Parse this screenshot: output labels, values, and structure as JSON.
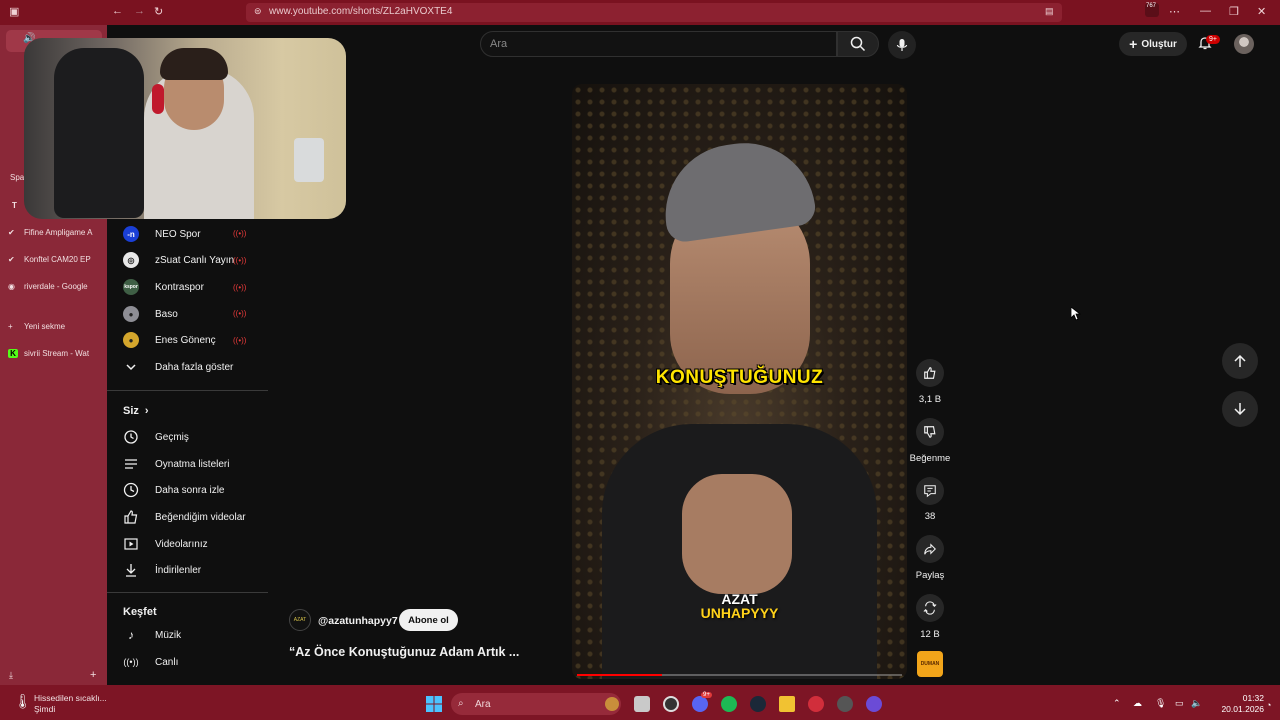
{
  "browser": {
    "url": "www.youtube.com/shorts/ZL2aHVOXTE4",
    "tab_count_badge": "767"
  },
  "tab_strip": {
    "section_label": "Spa",
    "pinned_letter": "T",
    "tabs": [
      {
        "label": "Fifine Ampligame A"
      },
      {
        "label": "Konftel CAM20 EP"
      },
      {
        "label": "riverdale - Google"
      }
    ],
    "new_tab_label": "Yeni sekme",
    "active_tab_label": "sivrii Stream - Wat"
  },
  "header": {
    "search_placeholder": "Ara",
    "create_label": "Oluştur",
    "notif_badge": "9+"
  },
  "sidebar": {
    "subscriptions": [
      {
        "name": "NEO Spor",
        "avatar": "n",
        "avatar_color": "#1a3fd6"
      },
      {
        "name": "zSuat Canlı Yayın",
        "avatar": "z",
        "avatar_color": "#e8e8e8"
      },
      {
        "name": "Kontraspor",
        "avatar": "k",
        "avatar_color": "#3f5f45"
      },
      {
        "name": "Baso",
        "avatar": "b",
        "avatar_color": "#8e8e95"
      },
      {
        "name": "Enes Gönenç",
        "avatar": "e",
        "avatar_color": "#d4a62c"
      }
    ],
    "show_more": "Daha fazla göster",
    "you_heading": "Siz",
    "you_items": [
      {
        "label": "Geçmiş",
        "icon": "history-icon"
      },
      {
        "label": "Oynatma listeleri",
        "icon": "playlists-icon"
      },
      {
        "label": "Daha sonra izle",
        "icon": "watch-later-icon"
      },
      {
        "label": "Beğendiğim videolar",
        "icon": "liked-icon"
      },
      {
        "label": "Videolarınız",
        "icon": "your-videos-icon"
      },
      {
        "label": "İndirilenler",
        "icon": "downloads-icon"
      }
    ],
    "explore_heading": "Keşfet",
    "explore_items": [
      {
        "label": "Müzik",
        "icon": "music-icon"
      },
      {
        "label": "Canlı",
        "icon": "live-icon"
      }
    ]
  },
  "short": {
    "caption": "KONUŞTUĞUNUZ",
    "watermark_line1": "AZAT",
    "watermark_line2": "UNHAPYYY",
    "progress": 0.26,
    "channel_handle": "@azatunhapyy7",
    "channel_avatar_text": "AZAT",
    "subscribe_label": "Abone ol",
    "title": "“Az Önce Konuştuğunuz Adam Artık ..."
  },
  "actions": {
    "likes": "3,1 B",
    "dislike_label": "Beğenme",
    "comments": "38",
    "share_label": "Paylaş",
    "remix_count": "12 B",
    "music_thumb_text": "DUMAN"
  },
  "taskbar": {
    "weather_line1": "Hissedilen sıcaklı...",
    "weather_line2": "Şimdi",
    "search_placeholder": "Ara",
    "discord_badge": "9+",
    "time": "01:32",
    "date": "20.01.2026"
  }
}
